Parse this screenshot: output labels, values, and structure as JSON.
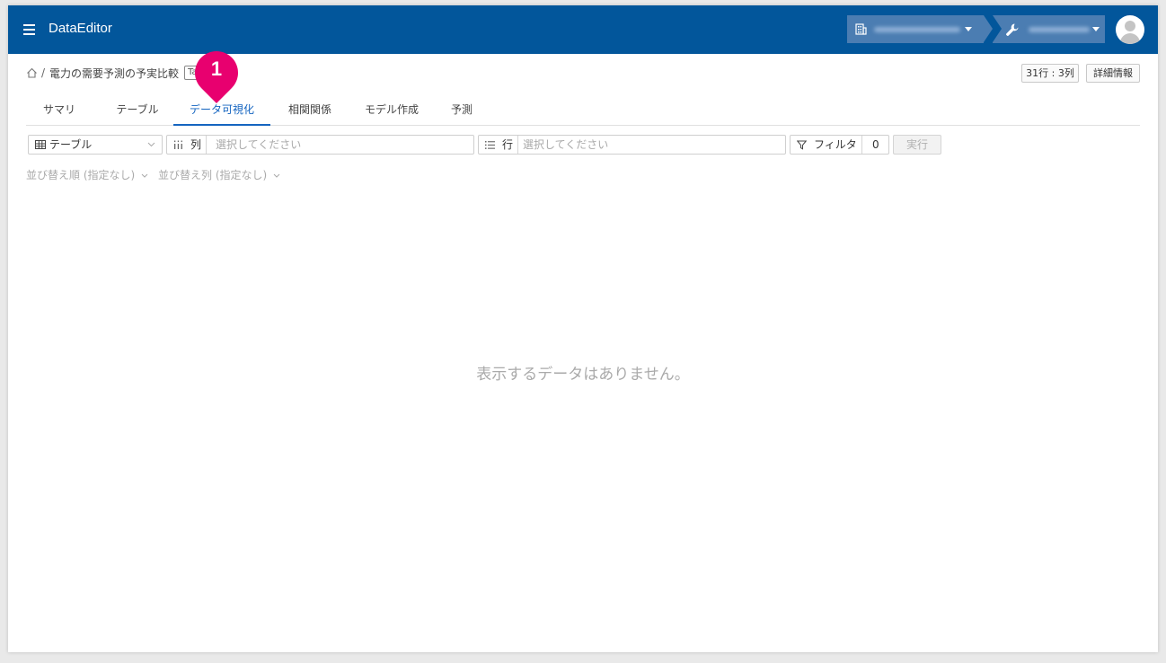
{
  "header": {
    "app_title": "DataEditor"
  },
  "breadcrumb": {
    "dataset_name": "電力の需要予測の予実比較",
    "separator": "/",
    "badge": "Ta"
  },
  "annotation": {
    "step_number": "1"
  },
  "top_buttons": {
    "size": "31行 : 3列",
    "details": "詳細情報"
  },
  "tabs": [
    {
      "label": "サマリ"
    },
    {
      "label": "テーブル"
    },
    {
      "label": "データ可視化"
    },
    {
      "label": "相関関係"
    },
    {
      "label": "モデル作成"
    },
    {
      "label": "予測"
    }
  ],
  "toolbar": {
    "view_select": "テーブル",
    "column_label": "列",
    "column_placeholder": "選択してください",
    "row_label": "行",
    "row_placeholder": "選択してください",
    "filter_label": "フィルタ",
    "filter_count": "0",
    "run_label": "実行"
  },
  "sort": {
    "order_label": "並び替え順 (指定なし)",
    "column_label": "並び替え列 (指定なし)"
  },
  "main": {
    "empty_message": "表示するデータはありません。"
  },
  "colors": {
    "header_bg": "#02569b",
    "accent": "#1565c0",
    "annotation_pin": "#e8006f"
  }
}
